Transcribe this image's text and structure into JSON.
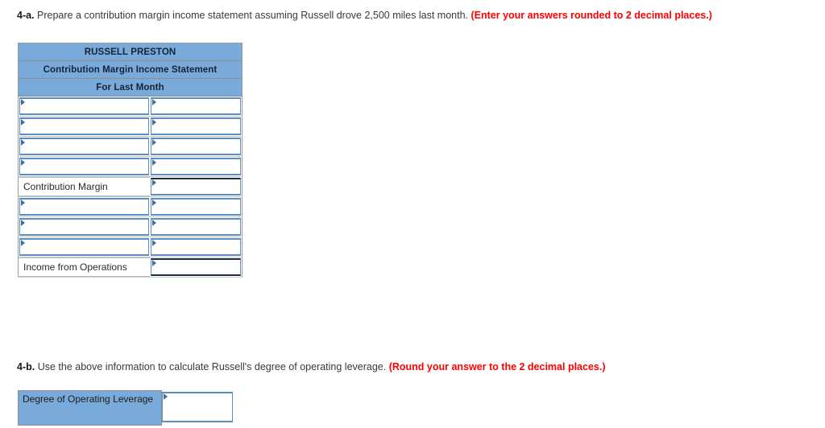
{
  "part_a": {
    "number": "4-a.",
    "text": " Prepare a contribution margin income statement assuming Russell drove 2,500 miles last month. ",
    "note": "(Enter your answers rounded to 2 decimal places.)"
  },
  "part_b": {
    "number": "4-b.",
    "text": " Use the above information to calculate Russell's degree of operating leverage. ",
    "note": "(Round your answer to the 2 decimal places.)"
  },
  "statement": {
    "titles": [
      "RUSSELL PRESTON",
      "Contribution Margin Income Statement",
      "For Last Month"
    ],
    "rows": [
      {
        "label": "",
        "label_editable": true,
        "value": "",
        "value_style": "normal"
      },
      {
        "label": "",
        "label_editable": true,
        "value": "",
        "value_style": "normal"
      },
      {
        "label": "",
        "label_editable": true,
        "value": "",
        "value_style": "normal"
      },
      {
        "label": "",
        "label_editable": true,
        "value": "",
        "value_style": "normal"
      },
      {
        "label": "Contribution Margin",
        "label_editable": false,
        "value": "",
        "value_style": "thick-top"
      },
      {
        "label": "",
        "label_editable": true,
        "value": "",
        "value_style": "normal"
      },
      {
        "label": "",
        "label_editable": true,
        "value": "",
        "value_style": "normal"
      },
      {
        "label": "",
        "label_editable": true,
        "value": "",
        "value_style": "normal"
      },
      {
        "label": "Income from Operations",
        "label_editable": false,
        "value": "",
        "value_style": "thick-both"
      }
    ]
  },
  "dol": {
    "label": "Degree of Operating Leverage",
    "value": ""
  },
  "colors": {
    "header_blue": "#79aada",
    "cell_border_blue": "#5b8ec4",
    "note_red": "#ff0000",
    "marker_blue": "#3d6ea6"
  }
}
